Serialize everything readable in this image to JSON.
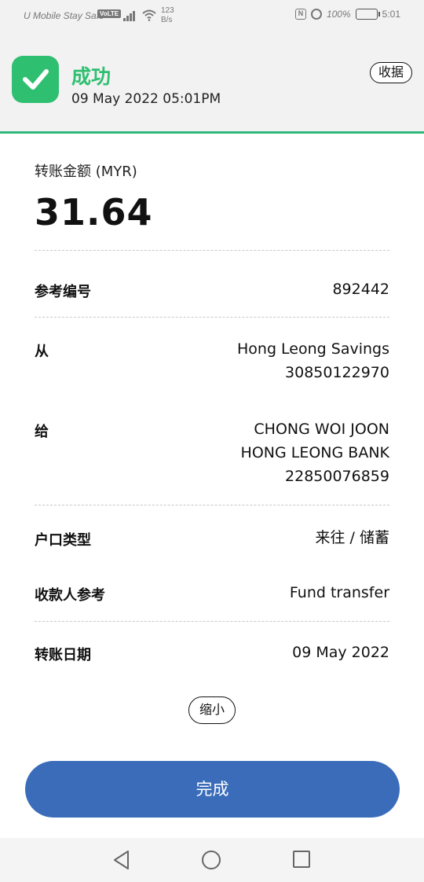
{
  "status_bar": {
    "carrier": "U Mobile Stay Safe",
    "volte": "VoLTE",
    "speed_value": "123",
    "speed_unit": "B/s",
    "nfc": "N",
    "battery_percent": "100%",
    "time": "5:01"
  },
  "header": {
    "status_title": "成功",
    "datetime": "09 May 2022 05:01PM",
    "receipt_label": "收据",
    "accent_color": "#2fbf71"
  },
  "transfer": {
    "amount_label": "转账金额 (MYR)",
    "amount": "31.64"
  },
  "details": {
    "reference": {
      "label": "参考编号",
      "value": "892442"
    },
    "from": {
      "label": "从",
      "lines": [
        "Hong Leong Savings",
        "30850122970"
      ]
    },
    "to": {
      "label": "给",
      "lines": [
        "CHONG WOI JOON",
        "HONG LEONG BANK",
        "22850076859"
      ]
    },
    "account_type": {
      "label": "户口类型",
      "value": "来往 / 储蓄"
    },
    "recipient_reference": {
      "label": "收款人参考",
      "value": "Fund transfer"
    },
    "transfer_date": {
      "label": "转账日期",
      "value": "09 May 2022"
    }
  },
  "actions": {
    "collapse_label": "缩小",
    "done_label": "完成",
    "primary_color": "#3a6cba"
  },
  "nav": {
    "icons": [
      "back-icon",
      "home-icon",
      "recent-apps-icon"
    ]
  }
}
